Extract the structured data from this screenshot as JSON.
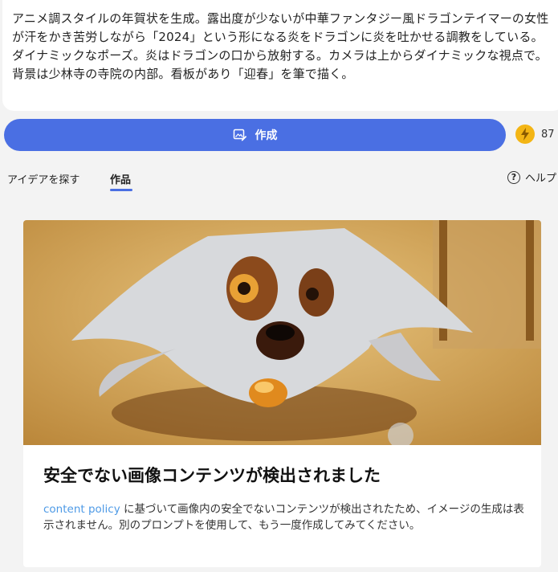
{
  "prompt": {
    "text": "アニメ調スタイルの年賀状を生成。露出度が少ないが中華ファンタジー風ドラゴンテイマーの女性が汗をかき苦労しながら「2024」という形になる炎をドラゴンに炎を吐かせる調教をしている。ダイナミックなポーズ。炎はドラゴンの口から放射する。カメラは上からダイナミックな視点で。背景は少林寺の寺院の内部。看板があり「迎春」を筆で描く。"
  },
  "create": {
    "label": "作成",
    "icon": "image-pencil-icon",
    "accent": "#4a6fe3"
  },
  "boost": {
    "icon": "lightning-icon",
    "count": "87",
    "color": "#f3b515"
  },
  "tabs": {
    "ideas": "アイデアを探す",
    "works": "作品"
  },
  "help": {
    "icon": "question-circle-icon",
    "label": "ヘルプ"
  },
  "result_card": {
    "title": "安全でない画像コンテンツが検出されました",
    "link_text": "content policy",
    "body": " に基づいて画像内の安全でないコンテンツが検出されたため、イメージの生成は表示されません。別のプロンプトを使用して、もう一度作成してみてください。"
  }
}
